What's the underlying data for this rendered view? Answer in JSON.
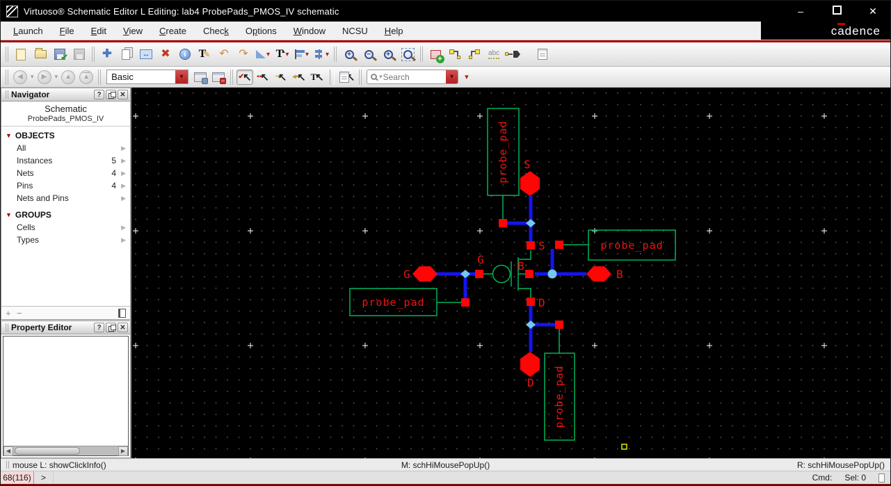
{
  "window": {
    "title": "Virtuoso® Schematic Editor L Editing: lab4 ProbePads_PMOS_IV schematic",
    "brand": {
      "pre": "c",
      "a": "a",
      "post": "dence"
    }
  },
  "menus": [
    {
      "pre": "",
      "accel": "L",
      "post": "aunch"
    },
    {
      "pre": "",
      "accel": "F",
      "post": "ile"
    },
    {
      "pre": "",
      "accel": "E",
      "post": "dit"
    },
    {
      "pre": "",
      "accel": "V",
      "post": "iew"
    },
    {
      "pre": "",
      "accel": "C",
      "post": "reate"
    },
    {
      "pre": "Chec",
      "accel": "k",
      "post": ""
    },
    {
      "pre": "O",
      "accel": "p",
      "post": "tions"
    },
    {
      "pre": "",
      "accel": "W",
      "post": "indow"
    },
    {
      "pre": "NCSU",
      "accel": "",
      "post": ""
    },
    {
      "pre": "",
      "accel": "H",
      "post": "elp"
    }
  ],
  "glyphs": {
    "check": "✔",
    "delete_x": "✖",
    "undo": "↶",
    "redo": "↷",
    "stretch": "↔",
    "move": "✚",
    "pencil": "✎",
    "info_i": "i",
    "text_t": "T",
    "tri_up": "▴",
    "abc": "abc",
    "dropdown": "▾",
    "nav_left": "◀",
    "nav_right": "▶",
    "nav_up": "▲",
    "plus": "+",
    "minus": "−",
    "mag_plus": "+",
    "mag_minus": "−",
    "help": "?",
    "close": "✕",
    "minimize": "–",
    "cursor": "↖",
    "sel_check": "✔",
    "sel_squares": "▪▪",
    "sel_wire": "¬",
    "sel_pin": "◂▪",
    "sel_text": "T",
    "section_arrow": "▼",
    "row_arrow": "▶",
    "scroll_left": "◀",
    "scroll_right": "▶"
  },
  "toolbar2": {
    "workspace_value": "Basic",
    "search_placeholder": "Search"
  },
  "navigator": {
    "title": "Navigator",
    "view_type": "Schematic",
    "cell_name": "ProbePads_PMOS_IV",
    "sections": [
      {
        "label": "OBJECTS",
        "items": [
          {
            "label": "All",
            "count": ""
          },
          {
            "label": "Instances",
            "count": "5"
          },
          {
            "label": "Nets",
            "count": "4"
          },
          {
            "label": "Pins",
            "count": "4"
          },
          {
            "label": "Nets and Pins",
            "count": ""
          }
        ]
      },
      {
        "label": "GROUPS",
        "items": [
          {
            "label": "Cells",
            "count": ""
          },
          {
            "label": "Types",
            "count": ""
          }
        ]
      }
    ]
  },
  "property_editor": {
    "title": "Property Editor"
  },
  "schematic": {
    "probe_pad_label": "probe_pad",
    "pin_s": "S",
    "pin_d": "D",
    "pin_g": "G",
    "pin_b": "B"
  },
  "statusbar": {
    "left": "mouse L: showClickInfo()",
    "middle": "M: schHiMousePopUp()",
    "right": "R: schHiMousePopUp()"
  },
  "cmdbar": {
    "counter": "68(116)",
    "prompt": ">",
    "cmd_label": "Cmd:",
    "sel_label": "Sel: 0"
  },
  "colors": {
    "wire_blue": "#1515ef",
    "instance_green": "#00b45a",
    "pin_red": "#ff0505",
    "label_red": "#ee1212",
    "junction_cyan": "#72c8f0",
    "accent_red": "#a40000",
    "origin_yellow": "#e8e800"
  }
}
